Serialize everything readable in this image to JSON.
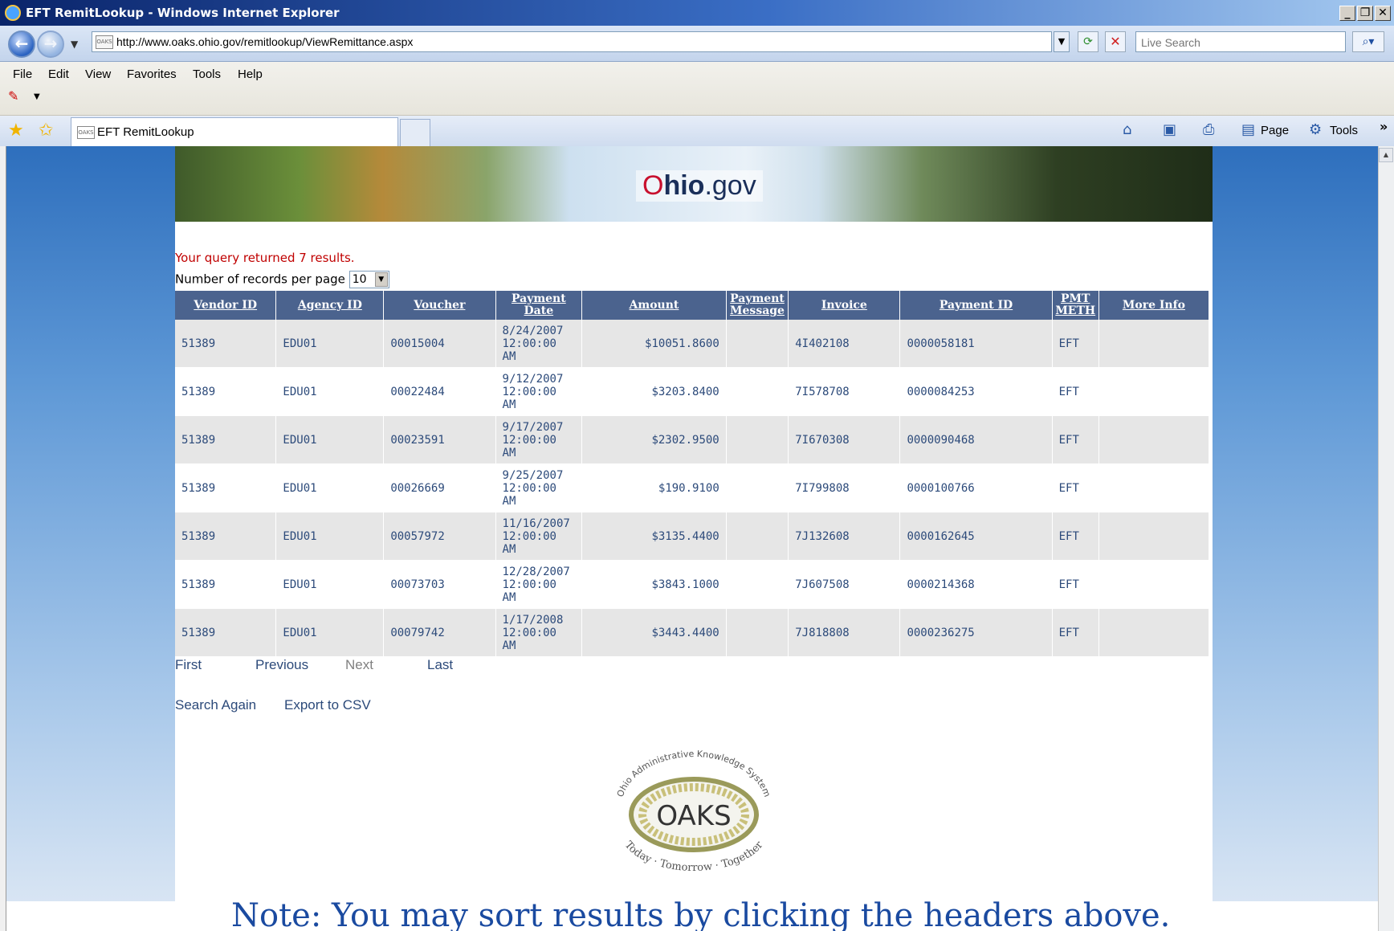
{
  "window": {
    "title": "EFT RemitLookup - Windows Internet Explorer",
    "controls": {
      "minimize": "_",
      "restore": "❐",
      "close": "✕"
    }
  },
  "address": {
    "url": "http://www.oaks.ohio.gov/remitlookup/ViewRemittance.aspx",
    "search_placeholder": "Live Search",
    "favicon_text": "OAKS"
  },
  "menu": [
    "File",
    "Edit",
    "View",
    "Favorites",
    "Tools",
    "Help"
  ],
  "tab": {
    "label": "EFT RemitLookup"
  },
  "commandbar": {
    "page_label": "Page",
    "tools_label": "Tools"
  },
  "site": {
    "logo_o": "O",
    "logo_hio": "hio",
    "logo_gov": ".gov"
  },
  "results": {
    "message": "Your query returned 7 results.",
    "per_page_label": "Number of records per page",
    "per_page_value": "10",
    "headers": [
      "Vendor ID",
      "Agency ID",
      "Voucher",
      "Payment Date",
      "Amount",
      "Payment Message",
      "Invoice",
      "Payment ID",
      "PMT METH",
      "More Info"
    ],
    "rows": [
      {
        "vendor": "51389",
        "agency": "EDU01",
        "voucher": "00015004",
        "date": "8/24/2007 12:00:00 AM",
        "amount": "$10051.8600",
        "message": "",
        "invoice": "4I402108",
        "payment_id": "0000058181",
        "method": "EFT",
        "more": ""
      },
      {
        "vendor": "51389",
        "agency": "EDU01",
        "voucher": "00022484",
        "date": "9/12/2007 12:00:00 AM",
        "amount": "$3203.8400",
        "message": "",
        "invoice": "7I578708",
        "payment_id": "0000084253",
        "method": "EFT",
        "more": ""
      },
      {
        "vendor": "51389",
        "agency": "EDU01",
        "voucher": "00023591",
        "date": "9/17/2007 12:00:00 AM",
        "amount": "$2302.9500",
        "message": "",
        "invoice": "7I670308",
        "payment_id": "0000090468",
        "method": "EFT",
        "more": ""
      },
      {
        "vendor": "51389",
        "agency": "EDU01",
        "voucher": "00026669",
        "date": "9/25/2007 12:00:00 AM",
        "amount": "$190.9100",
        "message": "",
        "invoice": "7I799808",
        "payment_id": "0000100766",
        "method": "EFT",
        "more": ""
      },
      {
        "vendor": "51389",
        "agency": "EDU01",
        "voucher": "00057972",
        "date": "11/16/2007 12:00:00 AM",
        "amount": "$3135.4400",
        "message": "",
        "invoice": "7J132608",
        "payment_id": "0000162645",
        "method": "EFT",
        "more": ""
      },
      {
        "vendor": "51389",
        "agency": "EDU01",
        "voucher": "00073703",
        "date": "12/28/2007 12:00:00 AM",
        "amount": "$3843.1000",
        "message": "",
        "invoice": "7J607508",
        "payment_id": "0000214368",
        "method": "EFT",
        "more": ""
      },
      {
        "vendor": "51389",
        "agency": "EDU01",
        "voucher": "00079742",
        "date": "1/17/2008 12:00:00 AM",
        "amount": "$3443.4400",
        "message": "",
        "invoice": "7J818808",
        "payment_id": "0000236275",
        "method": "EFT",
        "more": ""
      }
    ]
  },
  "pager": {
    "first": "First",
    "previous": "Previous",
    "next": "Next",
    "last": "Last"
  },
  "links": {
    "search_again": "Search Again",
    "export": "Export to CSV"
  },
  "oaks_logo": {
    "top_text": "Ohio Administrative Knowledge System",
    "name": "OAKS",
    "bottom_text": "Today · Tomorrow · Together"
  },
  "note": "Note:  You may sort results by clicking the headers above.",
  "colors": {
    "header_bg": "#4b638e",
    "query_msg": "#c00000",
    "link": "#2c4a7a",
    "note": "#1a4aa0"
  }
}
